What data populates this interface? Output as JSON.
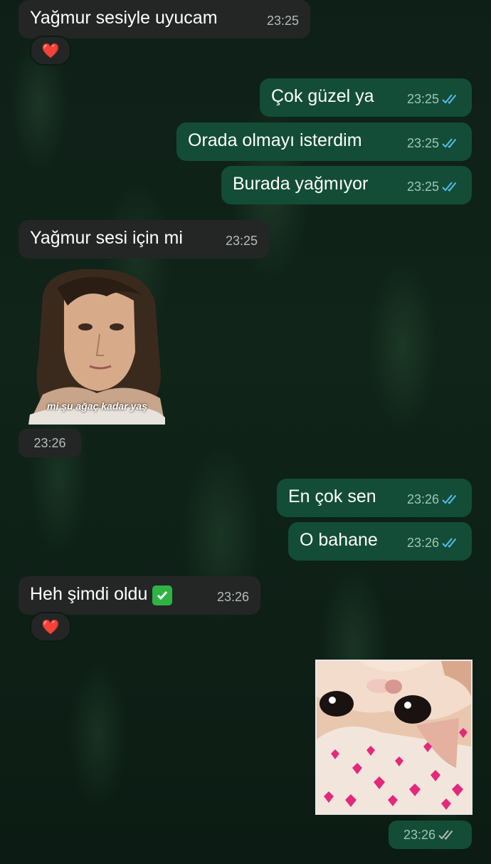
{
  "messages": [
    {
      "id": "m1",
      "text": "Yağmur sesiyle uyucam",
      "time": "23:25"
    },
    {
      "id": "m2",
      "text": "Çok güzel ya",
      "time": "23:25"
    },
    {
      "id": "m3",
      "text": "Orada olmayı isterdim",
      "time": "23:25"
    },
    {
      "id": "m4",
      "text": "Burada yağmıyor",
      "time": "23:25"
    },
    {
      "id": "m5",
      "text": "Yağmur sesi için mi",
      "time": "23:25"
    },
    {
      "id": "m6",
      "caption": "mi şu ağaç kadar yaş",
      "time": "23:26"
    },
    {
      "id": "m7",
      "text": "En çok sen",
      "time": "23:26"
    },
    {
      "id": "m8",
      "text": "O bahane",
      "time": "23:26"
    },
    {
      "id": "m9",
      "text": "Heh şimdi oldu",
      "emoji": "✅",
      "time": "23:26"
    },
    {
      "id": "m10",
      "time": "23:26"
    }
  ],
  "reaction": "❤️",
  "colors": {
    "incoming": "#242626",
    "outgoing": "#134d37",
    "read_tick": "#53bdeb",
    "sent_tick": "#b4bcb8",
    "emoji_check": "#2fb344"
  }
}
